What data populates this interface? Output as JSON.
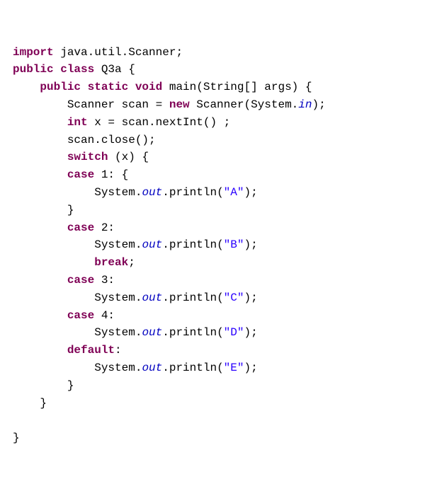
{
  "code": {
    "tokens": [
      {
        "t": "import ",
        "c": "kw"
      },
      {
        "t": "java.util.Scanner;",
        "c": "plain"
      },
      {
        "t": "\n",
        "c": "plain"
      },
      {
        "t": "public class ",
        "c": "kw"
      },
      {
        "t": "Q3a {",
        "c": "plain"
      },
      {
        "t": "\n",
        "c": "plain"
      },
      {
        "t": "    ",
        "c": "plain"
      },
      {
        "t": "public static void ",
        "c": "kw"
      },
      {
        "t": "main(String[] args) {",
        "c": "plain"
      },
      {
        "t": "\n",
        "c": "plain"
      },
      {
        "t": "        Scanner scan = ",
        "c": "plain"
      },
      {
        "t": "new ",
        "c": "kw"
      },
      {
        "t": "Scanner(System.",
        "c": "plain"
      },
      {
        "t": "in",
        "c": "field"
      },
      {
        "t": ");",
        "c": "plain"
      },
      {
        "t": "\n",
        "c": "plain"
      },
      {
        "t": "        ",
        "c": "plain"
      },
      {
        "t": "int ",
        "c": "kw"
      },
      {
        "t": "x = scan.nextInt() ;",
        "c": "plain"
      },
      {
        "t": "\n",
        "c": "plain"
      },
      {
        "t": "        scan.close();",
        "c": "plain"
      },
      {
        "t": "\n",
        "c": "plain"
      },
      {
        "t": "        ",
        "c": "plain"
      },
      {
        "t": "switch ",
        "c": "kw"
      },
      {
        "t": "(x) {",
        "c": "plain"
      },
      {
        "t": "\n",
        "c": "plain"
      },
      {
        "t": "        ",
        "c": "plain"
      },
      {
        "t": "case ",
        "c": "kw"
      },
      {
        "t": "1: {",
        "c": "plain"
      },
      {
        "t": "\n",
        "c": "plain"
      },
      {
        "t": "            System.",
        "c": "plain"
      },
      {
        "t": "out",
        "c": "field"
      },
      {
        "t": ".println(",
        "c": "plain"
      },
      {
        "t": "\"A\"",
        "c": "str"
      },
      {
        "t": ");",
        "c": "plain"
      },
      {
        "t": "\n",
        "c": "plain"
      },
      {
        "t": "        }",
        "c": "plain"
      },
      {
        "t": "\n",
        "c": "plain"
      },
      {
        "t": "        ",
        "c": "plain"
      },
      {
        "t": "case ",
        "c": "kw"
      },
      {
        "t": "2:",
        "c": "plain"
      },
      {
        "t": "\n",
        "c": "plain"
      },
      {
        "t": "            System.",
        "c": "plain"
      },
      {
        "t": "out",
        "c": "field"
      },
      {
        "t": ".println(",
        "c": "plain"
      },
      {
        "t": "\"B\"",
        "c": "str"
      },
      {
        "t": ");",
        "c": "plain"
      },
      {
        "t": "\n",
        "c": "plain"
      },
      {
        "t": "            ",
        "c": "plain"
      },
      {
        "t": "break",
        "c": "kw"
      },
      {
        "t": ";",
        "c": "plain"
      },
      {
        "t": "\n",
        "c": "plain"
      },
      {
        "t": "        ",
        "c": "plain"
      },
      {
        "t": "case ",
        "c": "kw"
      },
      {
        "t": "3:",
        "c": "plain"
      },
      {
        "t": "\n",
        "c": "plain"
      },
      {
        "t": "            System.",
        "c": "plain"
      },
      {
        "t": "out",
        "c": "field"
      },
      {
        "t": ".println(",
        "c": "plain"
      },
      {
        "t": "\"C\"",
        "c": "str"
      },
      {
        "t": ");",
        "c": "plain"
      },
      {
        "t": "\n",
        "c": "plain"
      },
      {
        "t": "        ",
        "c": "plain"
      },
      {
        "t": "case ",
        "c": "kw"
      },
      {
        "t": "4:",
        "c": "plain"
      },
      {
        "t": "\n",
        "c": "plain"
      },
      {
        "t": "            System.",
        "c": "plain"
      },
      {
        "t": "out",
        "c": "field"
      },
      {
        "t": ".println(",
        "c": "plain"
      },
      {
        "t": "\"D\"",
        "c": "str"
      },
      {
        "t": ");",
        "c": "plain"
      },
      {
        "t": "\n",
        "c": "plain"
      },
      {
        "t": "        ",
        "c": "plain"
      },
      {
        "t": "default",
        "c": "kw"
      },
      {
        "t": ":",
        "c": "plain"
      },
      {
        "t": "\n",
        "c": "plain"
      },
      {
        "t": "            System.",
        "c": "plain"
      },
      {
        "t": "out",
        "c": "field"
      },
      {
        "t": ".println(",
        "c": "plain"
      },
      {
        "t": "\"E\"",
        "c": "str"
      },
      {
        "t": ");",
        "c": "plain"
      },
      {
        "t": "\n",
        "c": "plain"
      },
      {
        "t": "        }",
        "c": "plain"
      },
      {
        "t": "\n",
        "c": "plain"
      },
      {
        "t": "    }",
        "c": "plain"
      },
      {
        "t": "\n",
        "c": "plain"
      },
      {
        "t": "\n",
        "c": "plain"
      },
      {
        "t": "}",
        "c": "plain"
      }
    ]
  }
}
